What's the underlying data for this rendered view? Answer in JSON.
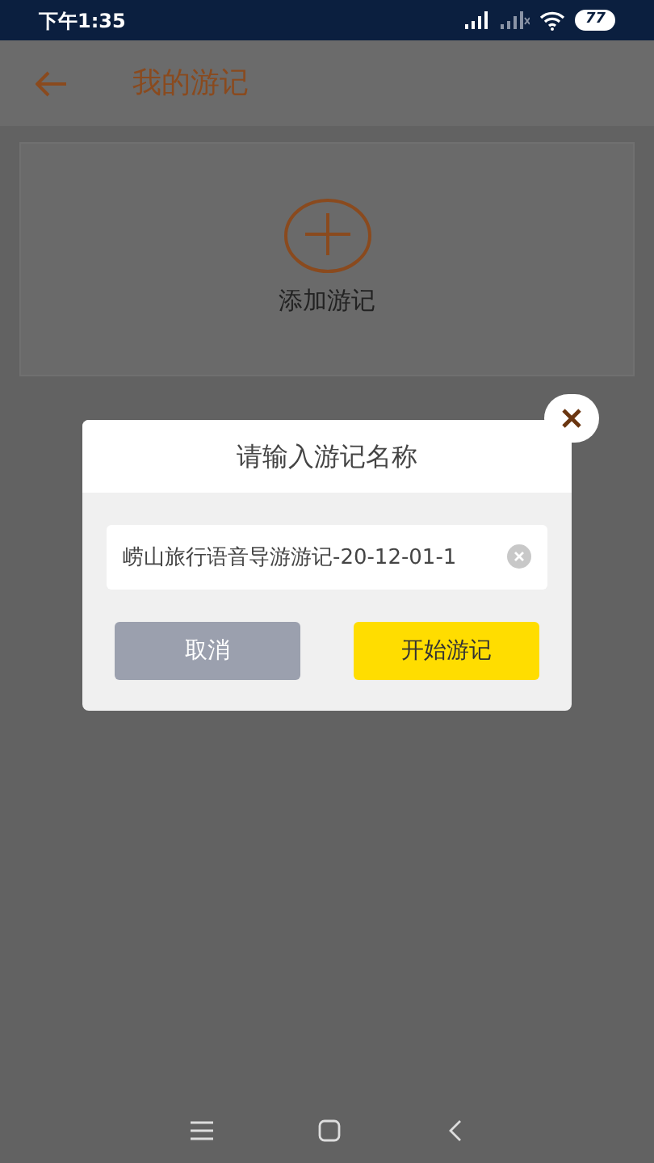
{
  "status_bar": {
    "time": "下午1:35",
    "battery": "77"
  },
  "header": {
    "title": "我的游记"
  },
  "add_card": {
    "label": "添加游记"
  },
  "dialog": {
    "title": "请输入游记名称",
    "input": {
      "value": "崂山旅行语音导游游记-20-12-01-1"
    },
    "buttons": [
      {
        "label": "取消",
        "kind": "cancel"
      },
      {
        "label": "开始游记",
        "kind": "primary"
      }
    ]
  }
}
